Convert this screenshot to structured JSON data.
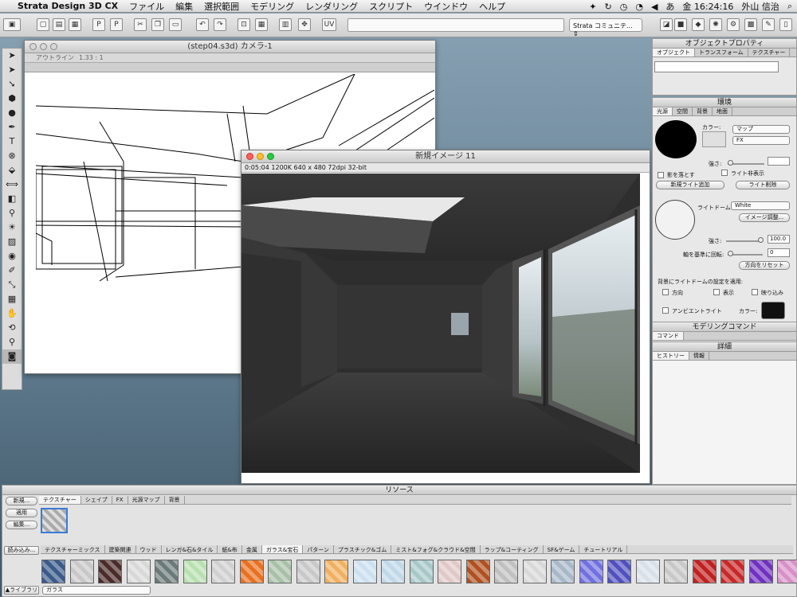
{
  "menubar": {
    "app_name": "Strata Design 3D CX",
    "items": [
      "ファイル",
      "編集",
      "選択範囲",
      "モデリング",
      "レンダリング",
      "スクリプト",
      "ウインドウ",
      "ヘルプ"
    ],
    "clock": "金 16:24:16",
    "user": "外山 信治"
  },
  "toolbar": {
    "community_label": "Strata コミュニテ..."
  },
  "camera_window": {
    "title": "(step04.s3d) カメラ-1",
    "outline_label": "アウトライン",
    "zoom_label": "1.33 : 1"
  },
  "render_window": {
    "title": "新規イメージ 11",
    "info": "0:05:04   1200K   640 x 480   72dpi   32-bit"
  },
  "object_props": {
    "title": "オブジェクトプロパティ",
    "tabs": [
      "オブジェクト",
      "トランスフォーム",
      "テクスチャー"
    ]
  },
  "environment": {
    "title": "環境",
    "tabs": [
      "光源",
      "空間",
      "背景",
      "地面"
    ],
    "color_label": "カラー:",
    "map_select": "マップ",
    "fx_select": "FX",
    "strength_label": "強さ:",
    "cast_shadow": "影を落とす",
    "hide_light": "ライト非表示",
    "add_light": "新規ライト追加",
    "delete_light": "ライト削除",
    "lightdome_label": "ライトドーム:",
    "lightdome_value": "White",
    "image_adjust": "イメージ調整...",
    "strength2_label": "強さ:",
    "strength2_value": "100.0",
    "rotate_label": "軸を基準に回転:",
    "rotate_value": "0",
    "reset_direction": "方向をリセット",
    "apply_bg_label": "背景にライトドームの設定を適用:",
    "opt_direction": "方向",
    "opt_display": "表示",
    "opt_reflect": "映り込み",
    "ambient_label": "アンビエントライト",
    "ambient_color_label": "カラー:",
    "ambient_color": "#111111"
  },
  "modeling_command": {
    "title": "モデリングコマンド",
    "tab": "コマンド"
  },
  "details": {
    "title": "詳細",
    "tabs": [
      "ヒストリー",
      "情報"
    ]
  },
  "resources": {
    "title": "リソース",
    "new_button": "新規...",
    "apply_button": "適用",
    "edit_button": "編集...",
    "load_button": "読み込み...",
    "library_button": "▲ライブラリ",
    "library_select": "ガラス",
    "tabs": [
      "テクスチャー",
      "シェイプ",
      "FX",
      "光源マップ",
      "背景"
    ],
    "categories": [
      "テクスチャーミックス",
      "建築関連",
      "ウッド",
      "レンガ&石&タイル",
      "紙&布",
      "金属",
      "ガラス&宝石",
      "パターン",
      "プラスチック&ゴム",
      "ミスト&フォグ&クラウド&空間",
      "ラップ&コーティング",
      "SF&ゲーム",
      "チュートリアル"
    ],
    "active_category": "ガラス&宝石",
    "swatch_colors": [
      "#3a5a8a",
      "#c8c8c8",
      "#4a2a2a",
      "#d8d8d8",
      "#6a7a78",
      "#b8e0b0",
      "#d0d0d0",
      "#e87020",
      "#a8c0a8",
      "#c8c8c8",
      "#f0b060",
      "#cce0f0",
      "#c0d8e8",
      "#a8c8c8",
      "#e0c8c8",
      "#b05020",
      "#c0c0c0",
      "#d8d8d8",
      "#a8b8c8",
      "#7070e0",
      "#5050c0",
      "#d8e0e8",
      "#c8c8c8",
      "#c02020",
      "#c82828",
      "#7030c0",
      "#d890c8"
    ]
  }
}
